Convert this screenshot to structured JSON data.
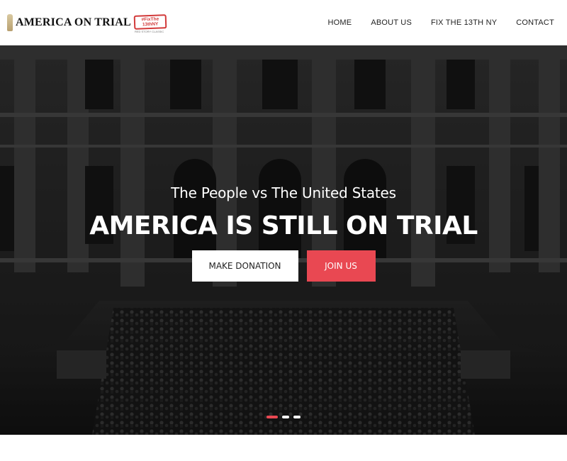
{
  "header": {
    "logo_text": "AMERICA ON TRIAL",
    "badge_lines": [
      "#FixThe",
      "13thNY"
    ],
    "badge_sub": "RED STORY CLASSIC"
  },
  "nav": {
    "items": [
      {
        "label": "HOME"
      },
      {
        "label": "ABOUT US"
      },
      {
        "label": "FIX THE 13TH NY"
      },
      {
        "label": "CONTACT"
      }
    ]
  },
  "hero": {
    "subtitle": "The People vs The United States",
    "title": "AMERICA IS STILL ON TRIAL",
    "buttons": {
      "donate": "MAKE DONATION",
      "join": "JOIN US"
    },
    "slider": {
      "count": 3,
      "active": 1
    }
  },
  "colors": {
    "accent": "#e94852",
    "nav_text": "#222222",
    "hero_overlay": "#000000"
  },
  "icons": {
    "logo": "statue-torch-icon"
  }
}
